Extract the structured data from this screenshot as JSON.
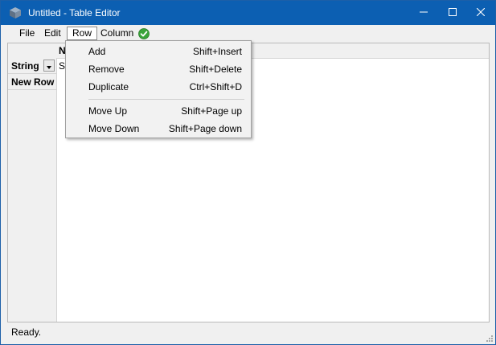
{
  "window": {
    "title": "Untitled - Table Editor",
    "accent_color": "#0c5fb2",
    "icon": "table-editor-app-icon",
    "controls": [
      "minimize-icon",
      "maximize-icon",
      "close-icon"
    ]
  },
  "menubar": {
    "items": [
      {
        "label": "File"
      },
      {
        "label": "Edit"
      },
      {
        "label": "Row"
      },
      {
        "label": "Column"
      }
    ],
    "open_menu": "Row",
    "status_icon": "green-check-icon"
  },
  "grid": {
    "column_header": "N",
    "type_label": "String",
    "type_value": "St",
    "new_row_label": "New Row"
  },
  "row_menu": {
    "items": [
      {
        "label": "Add",
        "shortcut": "Shift+Insert"
      },
      {
        "label": "Remove",
        "shortcut": "Shift+Delete"
      },
      {
        "label": "Duplicate",
        "shortcut": "Ctrl+Shift+D"
      },
      {
        "label": "Move Up",
        "shortcut": "Shift+Page up"
      },
      {
        "label": "Move Down",
        "shortcut": "Shift+Page down"
      }
    ]
  },
  "status": {
    "text": "Ready."
  }
}
